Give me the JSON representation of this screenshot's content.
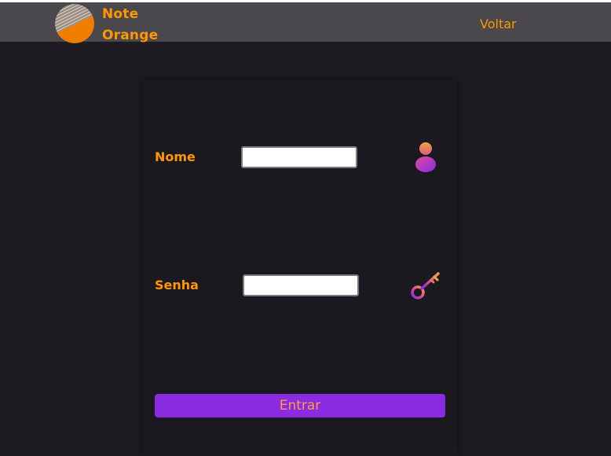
{
  "header": {
    "brand_line1": "Note",
    "brand_line2": "Orange",
    "back_label": "Voltar"
  },
  "login_form": {
    "name_label": "Nome",
    "name_value": "",
    "password_label": "Senha",
    "password_value": "",
    "submit_label": "Entrar",
    "user_icon": "user-icon",
    "key_icon": "key-icon"
  },
  "colors": {
    "page_background": "#1e1b22",
    "header_background": "#4a474d",
    "accent_orange": "#ff9800",
    "button_purple": "#8a2be2"
  }
}
